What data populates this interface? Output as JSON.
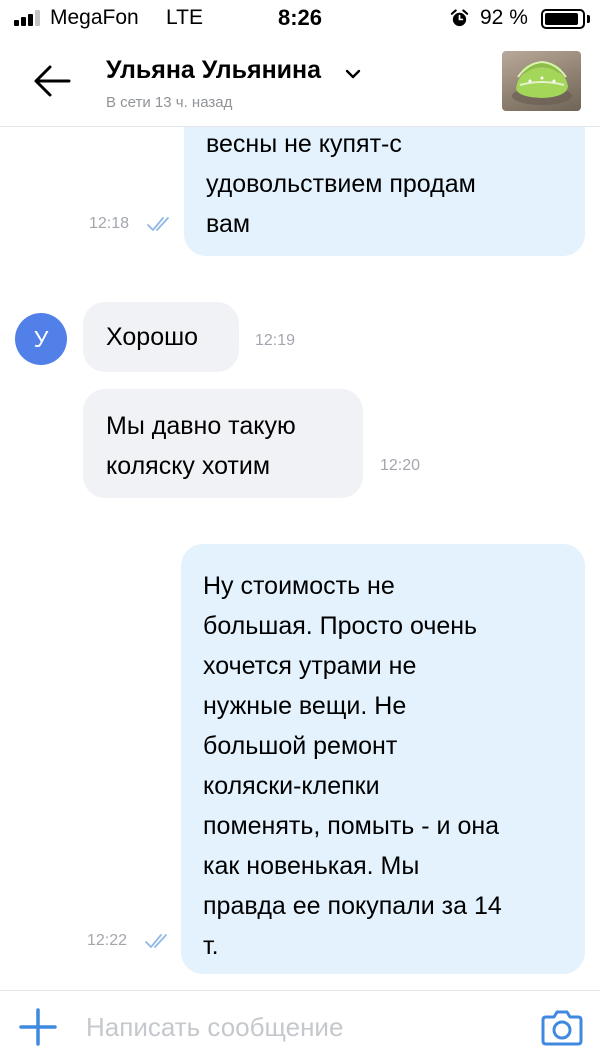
{
  "status_bar": {
    "carrier": "MegaFon",
    "network": "LTE",
    "time": "8:26",
    "battery_percent": "92 %",
    "battery_level": 0.92,
    "signal_bars": 3,
    "signal_bars_total": 4
  },
  "header": {
    "contact_name": "Ульяна Ульянина",
    "status": "В сети 13 ч. назад",
    "back_icon": "back-arrow-icon",
    "avatar": "product-photo-stroller"
  },
  "messages": [
    {
      "direction": "outgoing",
      "lines": [
        "весны не купят-с",
        "удовольствием продам",
        "вам"
      ],
      "time": "12:18",
      "read": true
    },
    {
      "direction": "incoming",
      "sender_initial": "У",
      "lines": [
        "Хорошо"
      ],
      "time": "12:19"
    },
    {
      "direction": "incoming",
      "lines": [
        "Мы давно такую",
        "коляску хотим"
      ],
      "time": "12:20"
    },
    {
      "direction": "outgoing",
      "lines": [
        "Ну стоимость не",
        "большая. Просто очень",
        "хочется утрами не",
        "нужные вещи. Не",
        "большой ремонт",
        "коляски-клепки",
        "поменять, помыть - и она",
        "как новенькая. Мы",
        "правда ее покупали за 14",
        "т."
      ],
      "time": "12:22",
      "read": true
    }
  ],
  "composer": {
    "placeholder": "Написать сообщение",
    "add_icon": "plus-icon",
    "camera_icon": "camera-icon"
  },
  "colors": {
    "accent": "#3f8ae0",
    "outgoing_bubble": "#e3f2fc",
    "incoming_bubble": "#f1f2f5",
    "avatar_bg": "#5181e8",
    "meta_text": "#a3a7ad"
  }
}
